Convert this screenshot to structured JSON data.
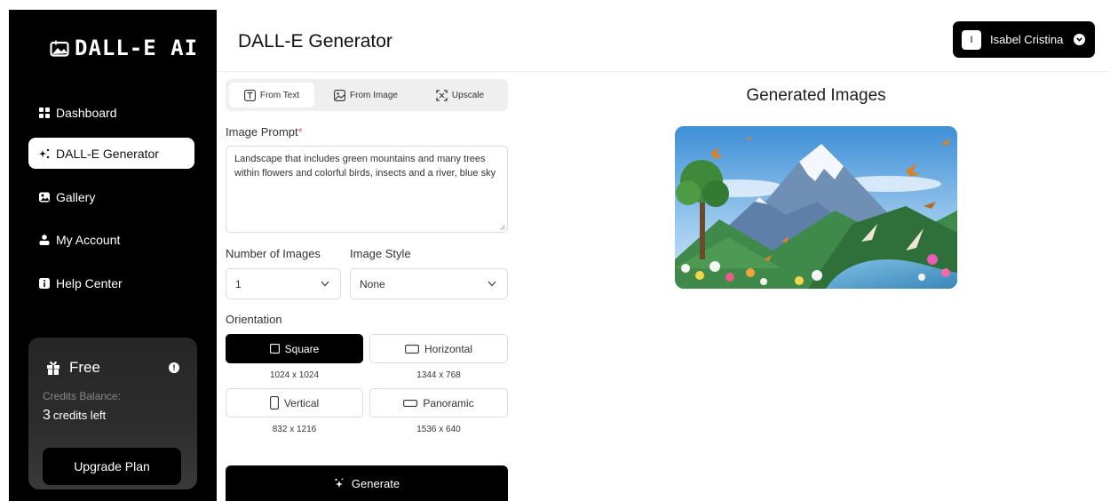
{
  "app": {
    "logo_text": "DALL-E AI",
    "page_title": "DALL-E Generator"
  },
  "user": {
    "initial": "I",
    "name": "Isabel Cristina"
  },
  "sidebar": {
    "items": [
      {
        "label": "Dashboard",
        "icon": "dashboard-icon",
        "active": false
      },
      {
        "label": "DALL-E Generator",
        "icon": "sparkle-icon",
        "active": true
      },
      {
        "label": "Gallery",
        "icon": "gallery-icon",
        "active": false
      },
      {
        "label": "My Account",
        "icon": "user-icon",
        "active": false
      },
      {
        "label": "Help Center",
        "icon": "info-icon",
        "active": false
      }
    ],
    "plan": {
      "name": "Free",
      "info_glyph": "!",
      "caption": "Credits Balance:",
      "credits_number": "3",
      "credits_suffix": "credits left",
      "upgrade_label": "Upgrade Plan"
    }
  },
  "tabs": [
    {
      "label": "From Text",
      "icon": "text-icon",
      "active": true
    },
    {
      "label": "From Image",
      "icon": "image-icon",
      "active": false
    },
    {
      "label": "Upscale",
      "icon": "upscale-icon",
      "active": false
    }
  ],
  "form": {
    "prompt_label": "Image Prompt",
    "prompt_required_mark": "*",
    "prompt_value": "Landscape that includes green mountains and many trees within flowers and colorful birds, insects and a river, blue sky",
    "num_images_label": "Number of Images",
    "num_images_value": "1",
    "style_label": "Image Style",
    "style_value": "None",
    "orientation_label": "Orientation",
    "orientations": [
      {
        "label": "Square",
        "dims": "1024 x 1024",
        "active": true
      },
      {
        "label": "Horizontal",
        "dims": "1344 x 768",
        "active": false
      },
      {
        "label": "Vertical",
        "dims": "832 x 1216",
        "active": false
      },
      {
        "label": "Panoramic",
        "dims": "1536 x 640",
        "active": false
      }
    ],
    "generate_label": "Generate"
  },
  "results": {
    "title": "Generated Images"
  }
}
